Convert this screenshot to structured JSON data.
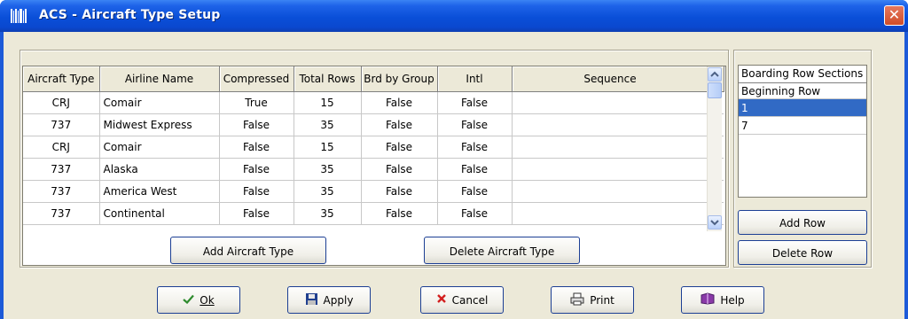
{
  "window": {
    "title": "ACS - Aircraft Type Setup",
    "close_glyph": "✕",
    "app_icon": "barcode-icon",
    "colors": {
      "titlebar": "#0a4fd8",
      "selection": "#316ac5",
      "client": "#ece9d8"
    }
  },
  "grid": {
    "columns": [
      "Aircraft Type",
      "Airline Name",
      "Compressed",
      "Total Rows",
      "Brd by Group",
      "Intl",
      "Sequence"
    ],
    "rows": [
      [
        "CRJ",
        "Comair",
        "True",
        "15",
        "False",
        "False",
        ""
      ],
      [
        "737",
        "Midwest Express",
        "False",
        "35",
        "False",
        "False",
        ""
      ],
      [
        "CRJ",
        "Comair",
        "False",
        "15",
        "False",
        "False",
        ""
      ],
      [
        "737",
        "Alaska",
        "False",
        "35",
        "False",
        "False",
        ""
      ],
      [
        "737",
        "America West",
        "False",
        "35",
        "False",
        "False",
        ""
      ],
      [
        "737",
        "Continental",
        "False",
        "35",
        "False",
        "False",
        ""
      ]
    ]
  },
  "actions": {
    "add_aircraft_type": "Add Aircraft Type",
    "delete_aircraft_type": "Delete Aircraft Type"
  },
  "boarding": {
    "header": "Boarding Row Sections",
    "column": "Beginning Row",
    "rows": [
      "1",
      "7"
    ],
    "selected_index": 0,
    "add_row": "Add Row",
    "delete_row": "Delete Row"
  },
  "footer": {
    "ok": "Ok",
    "apply": "Apply",
    "cancel": "Cancel",
    "print": "Print",
    "help": "Help",
    "icons": {
      "ok": "check-icon",
      "apply": "floppy-disk-icon",
      "cancel": "x-icon",
      "print": "printer-icon",
      "help": "help-book-icon"
    }
  }
}
